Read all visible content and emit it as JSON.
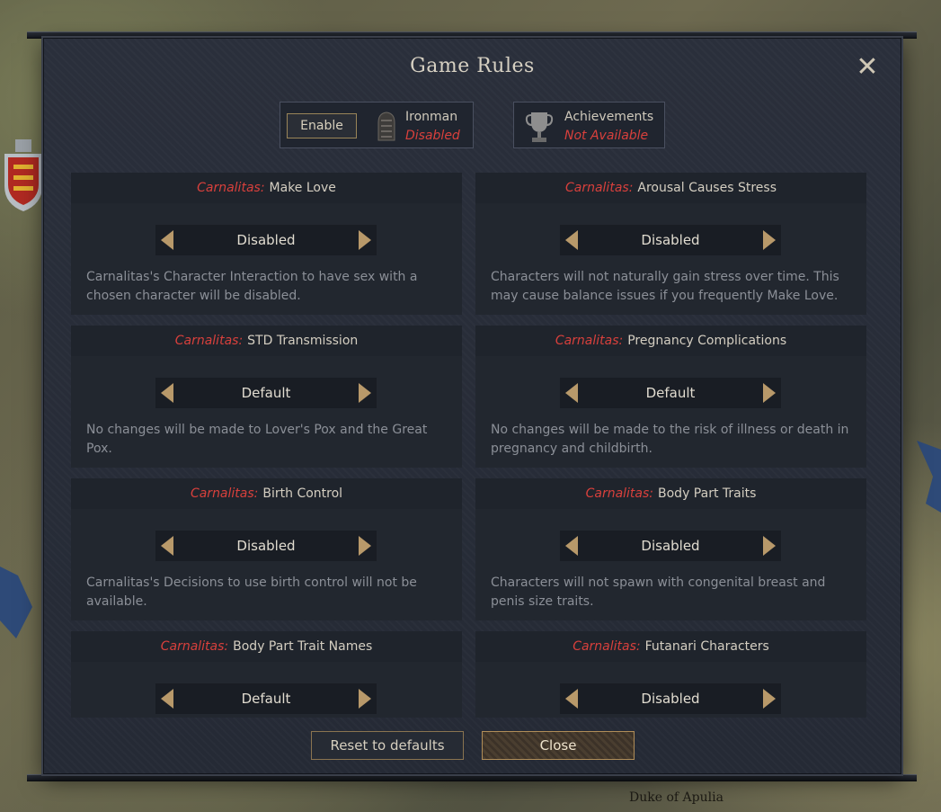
{
  "window": {
    "title": "Game Rules",
    "close_icon": "close-icon"
  },
  "ironman": {
    "enable_label": "Enable",
    "label": "Ironman",
    "status": "Disabled",
    "icon": "ironman-gauntlet-icon"
  },
  "achievements": {
    "label": "Achievements",
    "status": "Not Available",
    "icon": "trophy-icon"
  },
  "rules": [
    {
      "mod": "Carnalitas:",
      "name": "Make Love",
      "value": "Disabled",
      "desc": "Carnalitas's Character Interaction to have sex with a chosen character will be disabled."
    },
    {
      "mod": "Carnalitas:",
      "name": "Arousal Causes Stress",
      "value": "Disabled",
      "desc": "Characters will not naturally gain stress over time. This may cause balance issues if you frequently Make Love."
    },
    {
      "mod": "Carnalitas:",
      "name": "STD Transmission",
      "value": "Default",
      "desc": "No changes will be made to Lover's Pox and the Great Pox."
    },
    {
      "mod": "Carnalitas:",
      "name": "Pregnancy Complications",
      "value": "Default",
      "desc": "No changes will be made to the risk of illness or death in pregnancy and childbirth."
    },
    {
      "mod": "Carnalitas:",
      "name": "Birth Control",
      "value": "Disabled",
      "desc": "Carnalitas's Decisions to use birth control will not be available."
    },
    {
      "mod": "Carnalitas:",
      "name": "Body Part Traits",
      "value": "Disabled",
      "desc": "Characters will not spawn with congenital breast and penis size traits."
    },
    {
      "mod": "Carnalitas:",
      "name": "Body Part Trait Names",
      "value": "Default",
      "desc": ""
    },
    {
      "mod": "Carnalitas:",
      "name": "Futanari Characters",
      "value": "Disabled",
      "desc": ""
    }
  ],
  "footer": {
    "reset_label": "Reset to defaults",
    "close_label": "Close"
  },
  "map": {
    "label": "Duke of Apulia"
  },
  "colors": {
    "accent_red": "#d8403c",
    "gold_arrow": "#b8996a",
    "panel_bg": "#252a35"
  }
}
